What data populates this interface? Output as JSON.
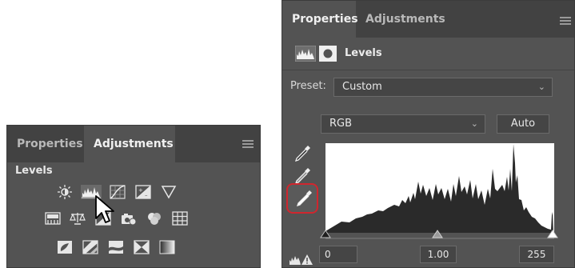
{
  "adjustments_panel": {
    "tabs": [
      {
        "label": "Properties"
      },
      {
        "label": "Adjustments"
      }
    ],
    "section_title": "Levels",
    "icons_row1": [
      "brightness-contrast-icon",
      "levels-icon",
      "curves-icon",
      "exposure-icon",
      "vibrance-icon"
    ],
    "icons_row2": [
      "hue-saturation-icon",
      "color-balance-icon",
      "black-white-icon",
      "photo-filter-icon",
      "channel-mixer-icon",
      "color-lookup-icon"
    ],
    "icons_row3": [
      "invert-icon",
      "posterize-icon",
      "threshold-icon",
      "selective-color-icon",
      "gradient-map-icon"
    ]
  },
  "properties_panel": {
    "tabs": [
      {
        "label": "Properties"
      },
      {
        "label": "Adjustments"
      }
    ],
    "title": "Levels",
    "preset_label": "Preset:",
    "preset_value": "Custom",
    "channel_value": "RGB",
    "auto_label": "Auto",
    "input_black": "0",
    "input_gamma": "1.00",
    "input_white": "255"
  },
  "colors": {
    "panel_bg": "#535353",
    "tab_bar": "#424242",
    "highlight": "#d0262e"
  }
}
